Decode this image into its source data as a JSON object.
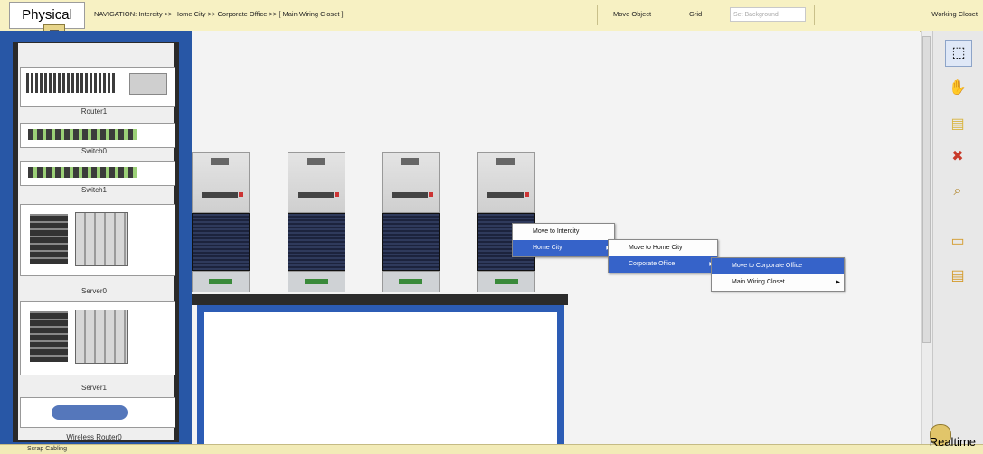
{
  "topbar": {
    "mode_label": "Physical",
    "navigation_label": "NAVIGATION:",
    "breadcrumb": [
      "Intercity >>",
      "Home City >>",
      "Corporate Office >>",
      "[ Main Wiring Closet ]"
    ],
    "buttons": [
      "Move Object",
      "Grid"
    ],
    "set_background": "Set Background",
    "working_closet": "Working Closet"
  },
  "rack": {
    "units": [
      {
        "label": "Router1"
      },
      {
        "label": "Switch0"
      },
      {
        "label": "Switch1"
      },
      {
        "label": "Server0"
      },
      {
        "label": "Server1"
      },
      {
        "label": "Wireless Router0"
      }
    ]
  },
  "context_menu": {
    "level1": [
      "Move to Intercity",
      "Home City"
    ],
    "level2": [
      "Move to Home City",
      "Corporate Office"
    ],
    "level3": [
      "Move to Corporate Office",
      "Main Wiring Closet"
    ]
  },
  "bottom": {
    "left_text": "Scrap Cabling",
    "right_text": "Realtime"
  },
  "colors": {
    "accent": "#f7f1c3",
    "rack": "#2857a6",
    "selection": "#3663c9"
  }
}
